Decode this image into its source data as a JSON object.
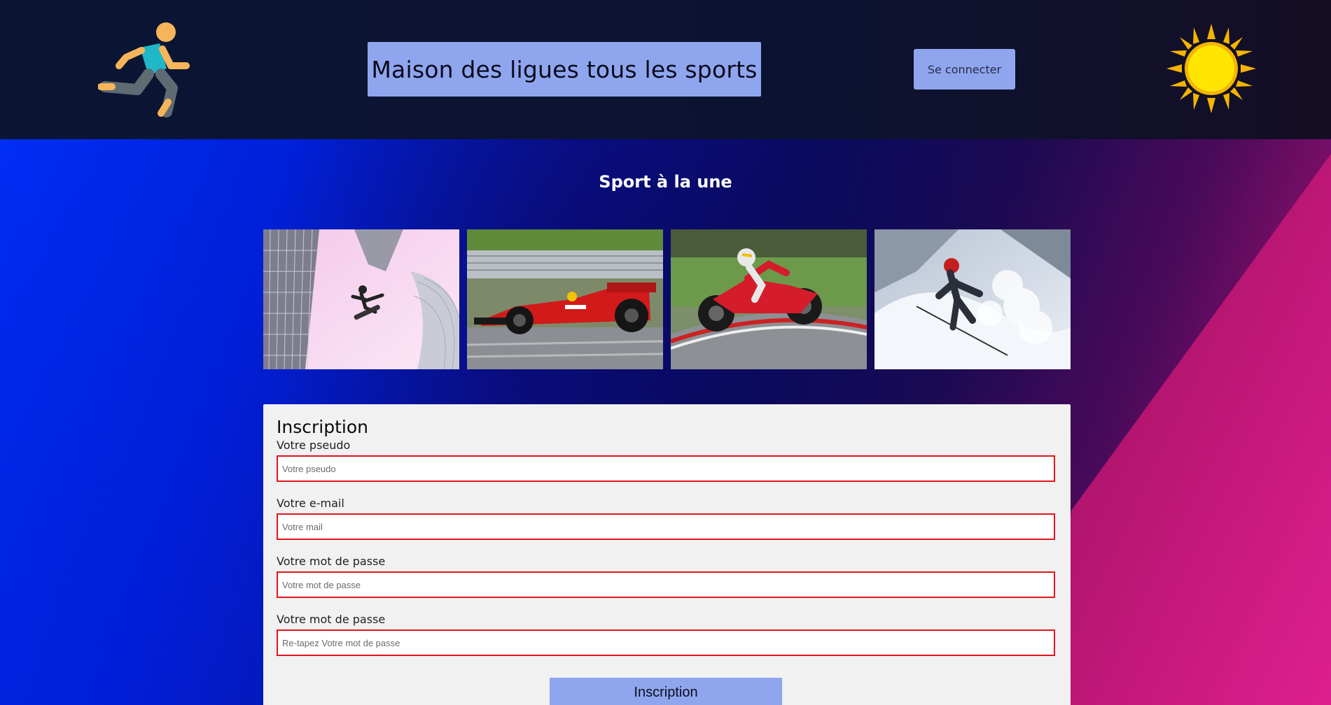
{
  "header": {
    "title": "Maison des ligues tous les sports",
    "login_label": "Se connecter",
    "logo_icon": "running-person-icon",
    "theme_icon": "sun-icon"
  },
  "featured": {
    "title": "Sport à la une",
    "images": [
      {
        "name": "skateboard-image"
      },
      {
        "name": "formula-one-image"
      },
      {
        "name": "motorcycle-image"
      },
      {
        "name": "ski-image"
      }
    ]
  },
  "signup": {
    "title": "Inscription",
    "fields": [
      {
        "label": "Votre pseudo",
        "placeholder": "Votre pseudo",
        "value": ""
      },
      {
        "label": "Votre e-mail",
        "placeholder": "Votre mail",
        "value": ""
      },
      {
        "label": "Votre mot de passe",
        "placeholder": "Votre mot de passe",
        "value": ""
      },
      {
        "label": "Votre mot de passe",
        "placeholder": "Re-tapez Votre mot de passe",
        "value": ""
      }
    ],
    "submit_label": "Inscription"
  },
  "colors": {
    "accent": "#8fa6ef",
    "header_bg": "#0c1331",
    "input_border": "#e3141b",
    "form_bg": "#f1f1f1"
  }
}
